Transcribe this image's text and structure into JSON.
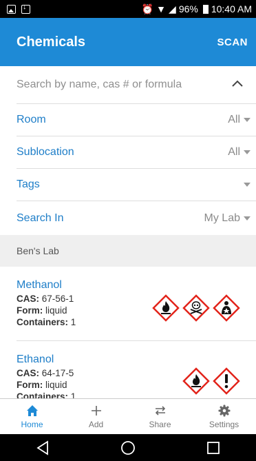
{
  "status_bar": {
    "battery": "96%",
    "time": "10:40 AM"
  },
  "app_bar": {
    "title": "Chemicals",
    "scan_label": "SCAN"
  },
  "search": {
    "placeholder": "Search by name, cas # or formula"
  },
  "filters": {
    "room": {
      "label": "Room",
      "value": "All"
    },
    "sublocation": {
      "label": "Sublocation",
      "value": "All"
    },
    "tags": {
      "label": "Tags",
      "value": ""
    },
    "search_in": {
      "label": "Search In",
      "value": "My Lab"
    }
  },
  "section_header": "Ben's Lab",
  "chemicals": [
    {
      "name": "Methanol",
      "cas_label": "CAS:",
      "cas": "67-56-1",
      "form_label": "Form:",
      "form": "liquid",
      "containers_label": "Containers:",
      "containers": "1",
      "hazards": [
        "flame-hazard-icon",
        "skull-crossbones-hazard-icon",
        "health-hazard-icon"
      ]
    },
    {
      "name": "Ethanol",
      "cas_label": "CAS:",
      "cas": "64-17-5",
      "form_label": "Form:",
      "form": "liquid",
      "containers_label": "Containers:",
      "containers": "1",
      "hazards": [
        "flame-hazard-icon",
        "exclamation-hazard-icon"
      ]
    }
  ],
  "bottom_nav": {
    "home": "Home",
    "add": "Add",
    "share": "Share",
    "settings": "Settings"
  },
  "colors": {
    "primary": "#1e8ad6",
    "link": "#1e7ec8",
    "hazard_red": "#e2231a"
  }
}
